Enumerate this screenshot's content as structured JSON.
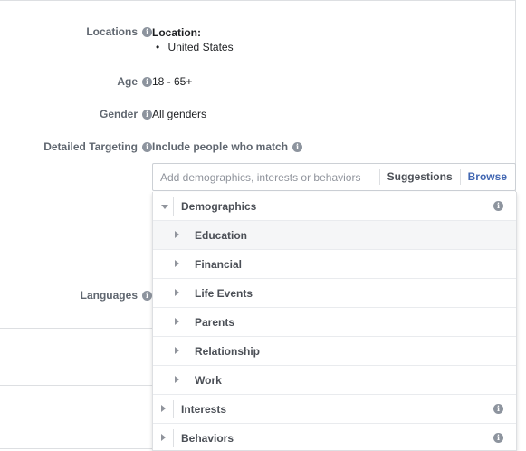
{
  "form": {
    "locations": {
      "label": "Locations",
      "heading": "Location:",
      "items": [
        "United States"
      ]
    },
    "age": {
      "label": "Age",
      "value": "18 - 65+"
    },
    "gender": {
      "label": "Gender",
      "value": "All genders"
    },
    "detailed_targeting": {
      "label": "Detailed Targeting",
      "include_text": "Include people who match",
      "search_placeholder": "Add demographics, interests or behaviors",
      "suggestions_label": "Suggestions",
      "browse_label": "Browse"
    },
    "languages": {
      "label": "Languages"
    }
  },
  "browse_menu": {
    "categories": [
      {
        "label": "Demographics",
        "expanded": true,
        "subcategories": [
          {
            "label": "Education"
          },
          {
            "label": "Financial"
          },
          {
            "label": "Life Events"
          },
          {
            "label": "Parents"
          },
          {
            "label": "Relationship"
          },
          {
            "label": "Work"
          }
        ]
      },
      {
        "label": "Interests",
        "expanded": false
      },
      {
        "label": "Behaviors",
        "expanded": false
      }
    ]
  },
  "icons": {
    "info": "info-icon",
    "caret_down": "caret-down-icon",
    "caret_right": "caret-right-icon"
  },
  "colors": {
    "link_blue": "#4267b2",
    "label_gray": "#606770",
    "border": "#dddfe2",
    "hover_bg": "#f5f6f7"
  }
}
